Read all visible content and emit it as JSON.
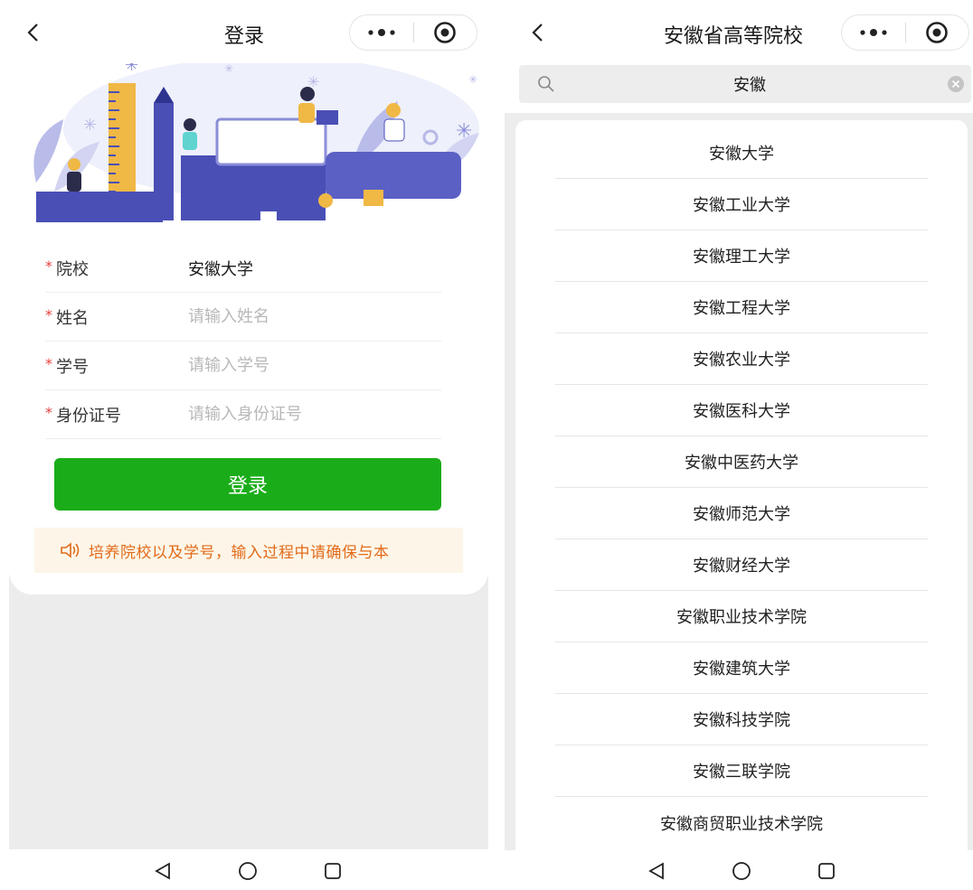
{
  "colors": {
    "primary_green": "#1aad19",
    "required_mark": "#e64340",
    "notice_text": "#e26b1a",
    "notice_bg": "#fdf6e8",
    "hero_purple": "#4a4fb6"
  },
  "left": {
    "nav": {
      "back_icon": "chevron-left-icon",
      "title": "登录",
      "more_icon": "more-dots-icon",
      "close_icon": "target-circle-icon"
    },
    "form": {
      "required_mark": "*",
      "school": {
        "label": "院校",
        "value": "安徽大学"
      },
      "name": {
        "label": "姓名",
        "placeholder": "请输入姓名",
        "value": ""
      },
      "student_id": {
        "label": "学号",
        "placeholder": "请输入学号",
        "value": ""
      },
      "id_card": {
        "label": "身份证号",
        "placeholder": "请输入身份证号",
        "value": ""
      }
    },
    "login_button": "登录",
    "notice": {
      "icon": "speaker-icon",
      "text": "培养院校以及学号，输入过程中请确保与本"
    }
  },
  "right": {
    "nav": {
      "back_icon": "chevron-left-icon",
      "title": "安徽省高等院校",
      "more_icon": "more-dots-icon",
      "close_icon": "target-circle-icon"
    },
    "search": {
      "icon": "search-icon",
      "value": "安徽",
      "clear_icon": "clear-icon"
    },
    "schools": [
      "安徽大学",
      "安徽工业大学",
      "安徽理工大学",
      "安徽工程大学",
      "安徽农业大学",
      "安徽医科大学",
      "安徽中医药大学",
      "安徽师范大学",
      "安徽财经大学",
      "安徽职业技术学院",
      "安徽建筑大学",
      "安徽科技学院",
      "安徽三联学院",
      "安徽商贸职业技术学院"
    ]
  },
  "system_nav": {
    "back": "back-triangle-icon",
    "home": "home-circle-icon",
    "recents": "recents-square-icon"
  }
}
